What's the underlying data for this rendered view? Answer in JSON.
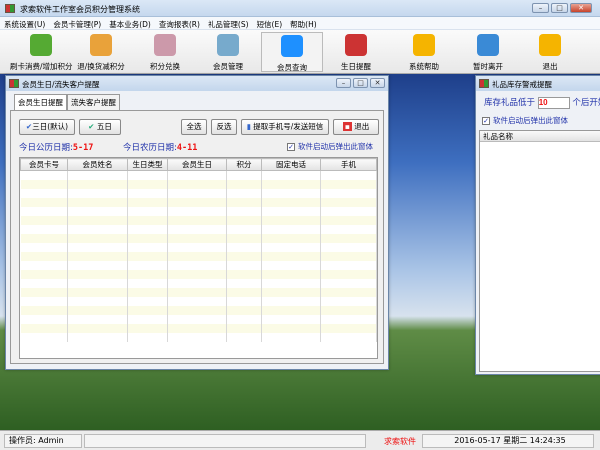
{
  "app": {
    "title": "求索软件工作室会员积分管理系统"
  },
  "menu": [
    "系统设置(U)",
    "会员卡管理(P)",
    "基本业务(D)",
    "查询报表(R)",
    "礼品管理(S)",
    "短信(E)",
    "帮助(H)"
  ],
  "toolbar": [
    {
      "label": "刷卡消费/增加积分",
      "icon": "card-consume-icon",
      "color": "#5a3"
    },
    {
      "label": "退/换货减积分",
      "icon": "return-goods-icon",
      "color": "#e9a23a"
    },
    {
      "label": "积分兑换",
      "icon": "points-exchange-icon",
      "color": "#c9a"
    },
    {
      "label": "会员管理",
      "icon": "member-manage-icon",
      "color": "#7ac"
    },
    {
      "label": "会员查询",
      "icon": "search-icon",
      "color": "#1e90ff"
    },
    {
      "label": "生日提醒",
      "icon": "birthday-icon",
      "color": "#c33"
    },
    {
      "label": "系统帮助",
      "icon": "help-icon",
      "color": "#f5b400"
    },
    {
      "label": "暂时离开",
      "icon": "lock-icon",
      "color": "#3a8ad6"
    },
    {
      "label": "退出",
      "icon": "exit-icon",
      "color": "#f5b400"
    }
  ],
  "birthday_window": {
    "title": "会员生日/流失客户提醒",
    "tabs": [
      "会员生日提醒",
      "流失客户提醒"
    ],
    "buttons": {
      "three_days": "三日(默认)",
      "five_days": "五日",
      "select_all": "全选",
      "invert": "反选",
      "sms": "提取手机号/发送短信",
      "exit": "退出"
    },
    "solar_label": "今日公历日期:",
    "solar_value": "5-17",
    "lunar_label": "今日农历日期:",
    "lunar_value": "4-11",
    "popup_checkbox": "软件启动后弹出此窗体",
    "columns": [
      "会员卡号",
      "会员姓名",
      "生日类型",
      "会员生日",
      "积分",
      "固定电话",
      "手机"
    ]
  },
  "gift_window": {
    "title": "礼品库存警戒提醒",
    "stock_label": "库存礼品低于",
    "stock_value": "10",
    "stock_suffix": "个后开始",
    "popup_checkbox": "软件启动后弹出此窗体",
    "column": "礼品名称"
  },
  "status": {
    "operator": "操作员: Admin",
    "brand": "求索软件",
    "datetime": "2016-05-17 星期二 14:24:35"
  }
}
